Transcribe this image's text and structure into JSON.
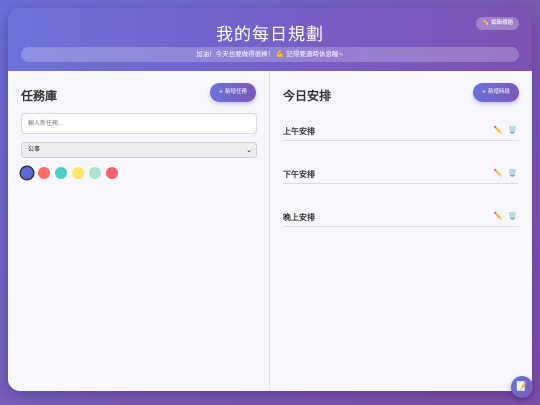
{
  "header": {
    "title": "我的每日規劃",
    "edit_button": "✏️ 編輯標題",
    "motto": "加油！今天也要做得很棒！ 💪 記得要適時休息喔~"
  },
  "task_pool": {
    "title": "任務庫",
    "add_button": "+ 新增任務",
    "input_placeholder": "輸入新任務...",
    "category_selected": "公事",
    "colors": [
      "#5b6ad6",
      "#ff6b6b",
      "#4ecdc4",
      "#ffe66d",
      "#a8e6cf",
      "#f25f6f"
    ],
    "selected_color_index": 0
  },
  "schedule": {
    "title": "今日安排",
    "add_button": "+ 新增時段",
    "slots": [
      {
        "label": "上午安排"
      },
      {
        "label": "下午安排"
      },
      {
        "label": "晚上安排"
      }
    ]
  },
  "fab": {
    "icon": "notepad-icon"
  }
}
